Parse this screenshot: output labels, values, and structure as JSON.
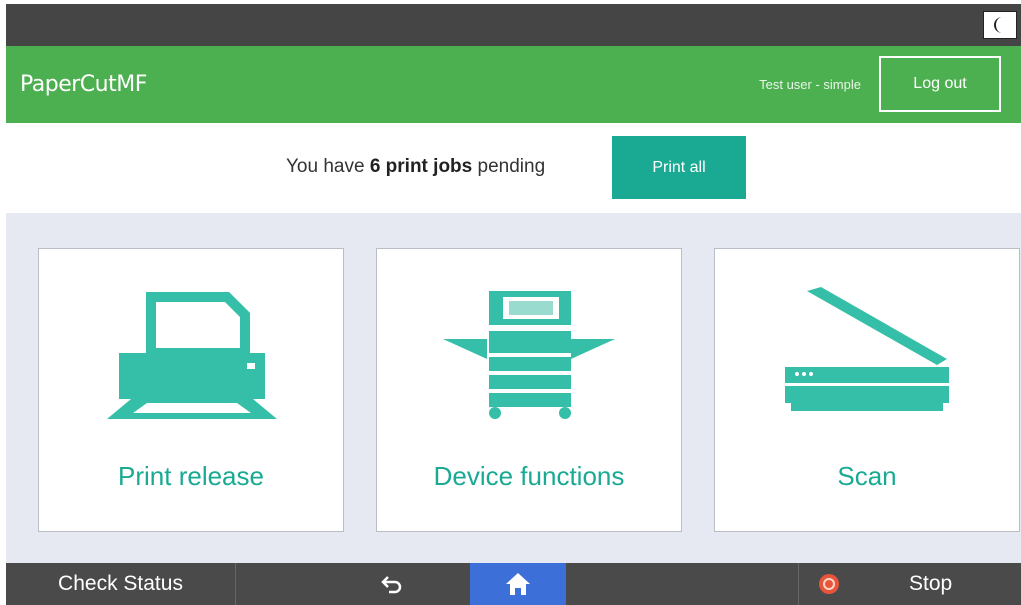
{
  "system_bar": {
    "night_mode_icon": "crescent-moon-icon"
  },
  "header": {
    "logo_main": "PaperCut",
    "logo_suffix": "MF",
    "username": "Test user - simple",
    "logout_label": "Log out",
    "brand_color": "#4caf50"
  },
  "pending": {
    "prefix": "You have ",
    "count_text": "6 print jobs",
    "suffix": " pending",
    "print_all_label": "Print all",
    "accent_color": "#1aaa93"
  },
  "tiles": [
    {
      "label": "Print release",
      "icon": "printer-icon"
    },
    {
      "label": "Device functions",
      "icon": "copier-icon"
    },
    {
      "label": "Scan",
      "icon": "scanner-icon"
    }
  ],
  "bottom_bar": {
    "check_status_label": "Check Status",
    "back_icon": "back-arrow-icon",
    "home_icon": "home-icon",
    "stop_icon": "stop-icon",
    "stop_label": "Stop"
  }
}
